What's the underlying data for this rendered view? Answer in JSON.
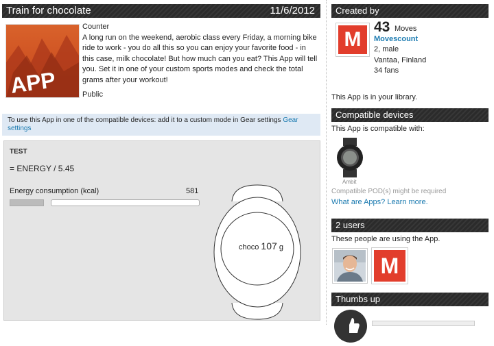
{
  "app": {
    "title": "Train for chocolate",
    "date": "11/6/2012",
    "thumbnail_text": "APP",
    "category": "Counter",
    "description": "A long run on the weekend, aerobic class every Friday, a morning bike ride to work - you do all this so you can enjoy your favorite food - in this case, milk chocolate! But how much can you eat? This App will tell you. Set it in one of your custom sports modes and check the total grams after your workout!",
    "visibility": "Public"
  },
  "info_bar": {
    "text": "To use this App in one of the compatible devices: add it to a custom mode in Gear settings ",
    "link": "Gear settings"
  },
  "simulator": {
    "test_label": "TEST",
    "formula": "= ENERGY / 5.45",
    "slider_label": "Energy consumption (kcal)",
    "slider_value": "581",
    "watch_label": "choco",
    "watch_value": "107",
    "watch_unit": "g"
  },
  "created_by": {
    "header": "Created by",
    "moves_count": "43",
    "moves_label": "Moves",
    "name": "Movescount",
    "details": "2, male",
    "location": "Vantaa, Finland",
    "fans": "34 fans",
    "library_note": "This App is in your library."
  },
  "compatible": {
    "header": "Compatible devices",
    "intro": "This App is compatible with:",
    "device_name": "Ambit",
    "pod_note": "Compatible POD(s) might be required",
    "link": "What are Apps? Learn more."
  },
  "users": {
    "header": "2 users",
    "intro": "These people are using the App."
  },
  "thumbs": {
    "header": "Thumbs up"
  },
  "colors": {
    "header_bg": "#2b2b2b",
    "link": "#1a7ab0",
    "brand_red": "#e23d2c",
    "info_bg": "#dfe9f4"
  }
}
